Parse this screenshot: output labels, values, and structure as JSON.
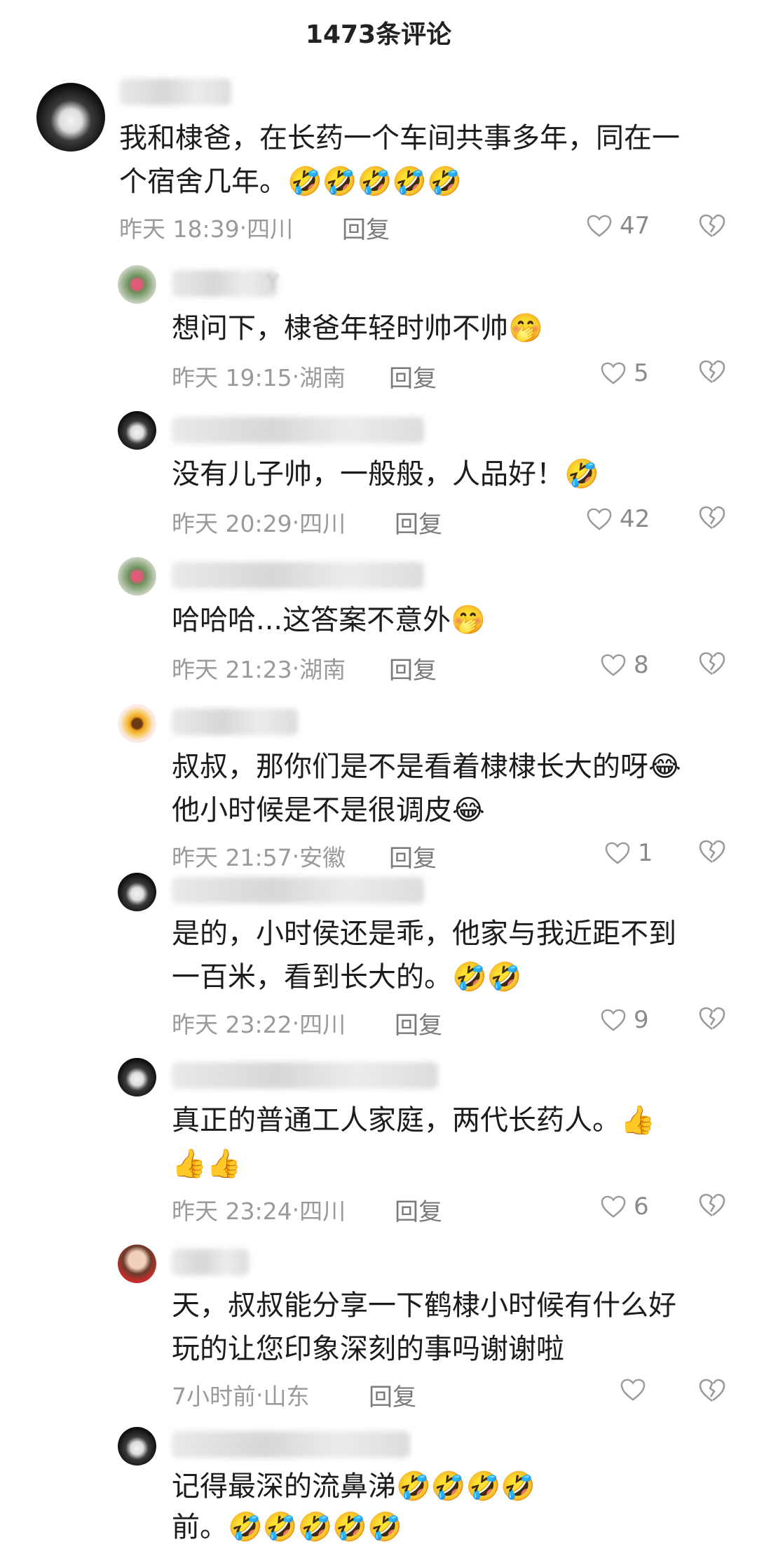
{
  "header": {
    "title": "1473条评论"
  },
  "comments": [
    {
      "avatar": "night-blooming-flower-avatar",
      "name_suffix": "",
      "lines": [
        "我和棣爸，在长药一个车间共事多年，同在一",
        "个宿舍几年。🤣🤣🤣🤣🤣"
      ],
      "time": "昨天 18:39",
      "location": "四川",
      "reply": "回复",
      "likes": "47"
    },
    {
      "avatar": "pink-flower-avatar",
      "name_suffix": "Y",
      "lines": [
        "想问下，棣爸年轻时帅不帅🤭"
      ],
      "time": "昨天 19:15",
      "location": "湖南",
      "reply": "回复",
      "likes": "5"
    },
    {
      "avatar": "night-blooming-flower-avatar",
      "name_suffix": "",
      "lines": [
        "没有儿子帅，一般般，人品好！🤣"
      ],
      "time": "昨天 20:29",
      "location": "四川",
      "reply": "回复",
      "likes": "42"
    },
    {
      "avatar": "pink-flower-avatar",
      "name_suffix": "",
      "lines": [
        "哈哈哈...这答案不意外🤭"
      ],
      "time": "昨天 21:23",
      "location": "湖南",
      "reply": "回复",
      "likes": "8"
    },
    {
      "avatar": "sunflower-avatar",
      "name_suffix": "",
      "lines": [
        "叔叔，那你们是不是看着棣棣长大的呀😂",
        "他小时候是不是很调皮😂"
      ],
      "time": "昨天 21:57",
      "location": "安徽",
      "reply": "回复",
      "likes": "1"
    },
    {
      "avatar": "night-blooming-flower-avatar",
      "name_suffix": "",
      "lines": [
        "是的，小时侯还是乖，他家与我近距不到",
        "一百米，看到长大的。🤣🤣"
      ],
      "time": "昨天 23:22",
      "location": "四川",
      "reply": "回复",
      "likes": "9"
    },
    {
      "avatar": "night-blooming-flower-avatar",
      "name_suffix": "",
      "lines": [
        "真正的普通工人家庭，两代长药人。👍",
        "👍👍"
      ],
      "time": "昨天 23:24",
      "location": "四川",
      "reply": "回复",
      "likes": "6"
    },
    {
      "avatar": "girl-photo-avatar",
      "name_suffix": "",
      "lines": [
        "天，叔叔能分享一下鹤棣小时候有什么好",
        "玩的让您印象深刻的事吗谢谢啦"
      ],
      "time": "7小时前",
      "location": "山东",
      "reply": "回复",
      "likes": ""
    },
    {
      "avatar": "night-blooming-flower-avatar",
      "name_suffix": "",
      "lines": [
        "记得最深的流鼻涕🤣🤣🤣🤣",
        "前。🤣🤣🤣🤣🤣"
      ],
      "time": "",
      "location": "",
      "reply": "",
      "likes": ""
    }
  ],
  "icons": {
    "like": "heart-outline-icon",
    "dislike": "broken-heart-icon"
  },
  "colors": {
    "text": "#1c1c1c",
    "meta": "#9a9a9a",
    "background": "#ffffff"
  }
}
